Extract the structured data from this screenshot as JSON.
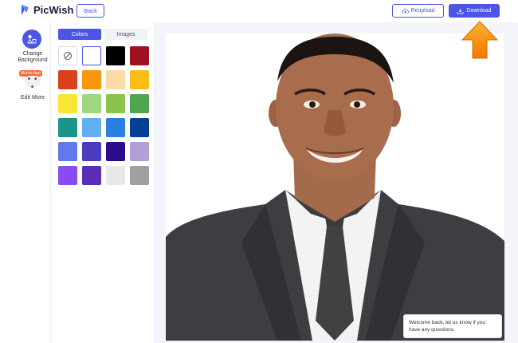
{
  "header": {
    "logo_text": "PicWish",
    "back_label": "Back",
    "reupload_label": "Reupload",
    "download_label": "Download",
    "accent_color": "#4b55e6"
  },
  "rail": {
    "change_background_label": "Change Background",
    "mobile_badge": "Mobile App",
    "more_glyph": "• • •",
    "edit_more_label": "Edit More"
  },
  "panel": {
    "tabs": [
      {
        "label": "Colors",
        "active": true
      },
      {
        "label": "Images",
        "active": false
      }
    ],
    "swatches": [
      "transparent",
      "#ffffff",
      "#000000",
      "#a0101e",
      "#d9401c",
      "#f7970f",
      "#fcdaa5",
      "#fbbd12",
      "#fbe635",
      "#9fd681",
      "#8ac44c",
      "#4ca74f",
      "#1a9688",
      "#64aff2",
      "#2b7fe3",
      "#063f96",
      "#6179ea",
      "#4a3cbf",
      "#2d0c8c",
      "#b19fd5",
      "#8a4cf0",
      "#5a2eb8",
      "#e8e8e8",
      "#a0a0a0"
    ]
  },
  "chat": {
    "message": "Welcome back, let us know if you have any questions."
  }
}
